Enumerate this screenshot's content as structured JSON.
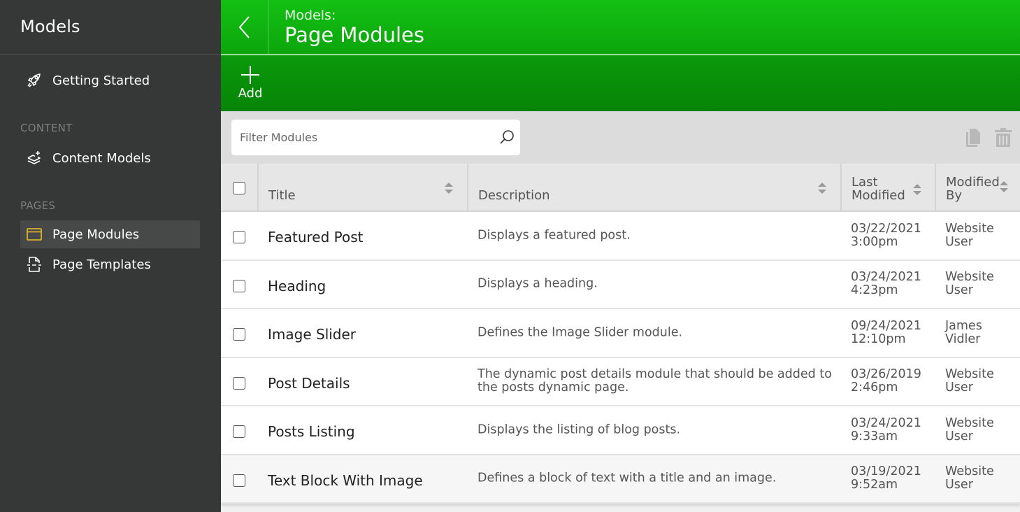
{
  "sidebar": {
    "title": "Models",
    "items": [
      {
        "label": "Getting Started",
        "icon": "rocket-icon"
      },
      {
        "label": "Content Models",
        "icon": "layers-plus-icon"
      },
      {
        "label": "Page Modules",
        "icon": "browser-window-icon",
        "active": true
      },
      {
        "label": "Page Templates",
        "icon": "page-template-icon"
      }
    ],
    "sections": {
      "content": "CONTENT",
      "pages": "PAGES"
    }
  },
  "header": {
    "subtitle": "Models:",
    "title": "Page Modules",
    "back_icon": "chevron-left-icon"
  },
  "toolbar": {
    "add_label": "Add",
    "add_icon": "plus-icon"
  },
  "filter": {
    "placeholder": "Filter Modules",
    "value": "",
    "search_icon": "search-icon",
    "copy_icon": "copy-icon",
    "delete_icon": "trash-icon"
  },
  "colors": {
    "accent_green": "#13c013",
    "sidebar_bg": "#363737",
    "active_icon": "#f0c02c"
  },
  "table": {
    "columns": [
      {
        "label": "Title",
        "sortable": true
      },
      {
        "label": "Description",
        "sortable": true
      },
      {
        "label": "Last Modified",
        "line1": "Last",
        "line2": "Modified",
        "sortable": true
      },
      {
        "label": "Modified By",
        "line1": "Modified",
        "line2": "By",
        "sortable": true
      }
    ],
    "rows": [
      {
        "title": "Featured Post",
        "description": "Displays a featured post.",
        "date": "03/22/2021",
        "time": "3:00pm",
        "user1": "Website",
        "user2": "User"
      },
      {
        "title": "Heading",
        "description": "Displays a heading.",
        "date": "03/24/2021",
        "time": "4:23pm",
        "user1": "Website",
        "user2": "User"
      },
      {
        "title": "Image Slider",
        "description": "Defines the Image Slider module.",
        "date": "09/24/2021",
        "time": "12:10pm",
        "user1": "James",
        "user2": "Vidler"
      },
      {
        "title": "Post Details",
        "description": "The dynamic post details module that should be added to the posts dynamic page.",
        "date": "03/26/2019",
        "time": "2:46pm",
        "user1": "Website",
        "user2": "User"
      },
      {
        "title": "Posts Listing",
        "description": "Displays the listing of blog posts.",
        "date": "03/24/2021",
        "time": "9:33am",
        "user1": "Website",
        "user2": "User"
      },
      {
        "title": "Text Block With Image",
        "description": "Defines a block of text with a title and an image.",
        "date": "03/19/2021",
        "time": "9:52am",
        "user1": "Website",
        "user2": "User"
      }
    ]
  }
}
